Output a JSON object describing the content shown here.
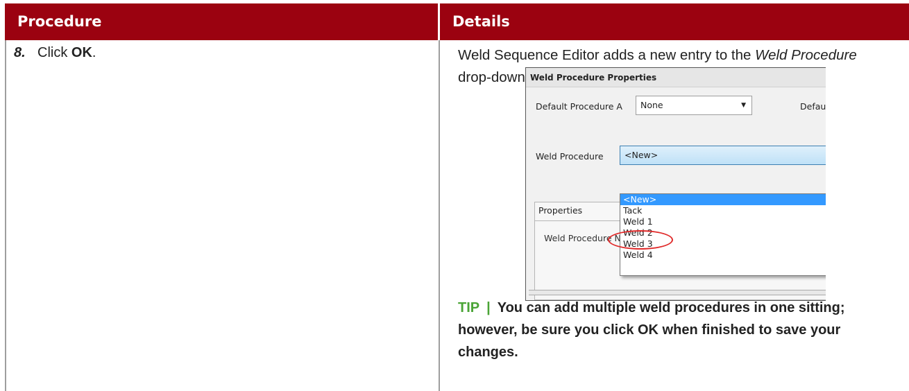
{
  "table": {
    "header_procedure": "Procedure",
    "header_details": "Details"
  },
  "step": {
    "number": "8.",
    "text_prefix": "Click ",
    "text_bold": "OK",
    "text_suffix": "."
  },
  "details": {
    "text_1": "Weld Sequence Editor adds a new entry to the ",
    "text_italic": "Weld Procedure",
    "text_2": " drop-down."
  },
  "dialog": {
    "title": "Weld Procedure Properties",
    "default_a_label": "Default Procedure A",
    "default_a_value": "None",
    "default_b_label_partial": "Defaul",
    "weld_procedure_label": "Weld Procedure",
    "weld_procedure_value": "<New>",
    "properties_tab": "Properties",
    "weld_procedure_name_label_partial": "Weld Procedure N",
    "dropdown_items": [
      "<New>",
      "Tack",
      "Weld 1",
      "Weld 2",
      "Weld 3",
      "Weld 4"
    ],
    "highlighted_item": "<New>",
    "circled_item": "Weld 2"
  },
  "tip": {
    "label": "TIP",
    "separator": "|",
    "text": "You can add multiple weld procedures in one sitting; however, be sure you click OK when finished to save your changes."
  },
  "colors": {
    "header_bg": "#9b0210",
    "tip_label": "#4aa436",
    "highlight": "#3399ff",
    "circle": "#e02a2a"
  }
}
